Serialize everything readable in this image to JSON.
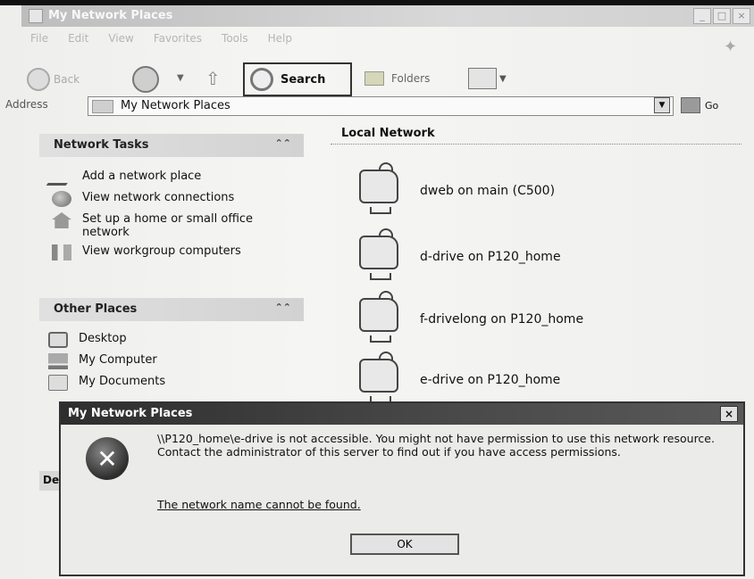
{
  "window": {
    "title": "My Network Places",
    "controls": [
      "_",
      "□",
      "×"
    ]
  },
  "menu": [
    "File",
    "Edit",
    "View",
    "Favorites",
    "Tools",
    "Help"
  ],
  "toolbar": {
    "back_label": "Back",
    "search_label": "Search",
    "folders_label": "Folders"
  },
  "address": {
    "label": "Address",
    "value": "My Network Places",
    "go_label": "Go"
  },
  "network_tasks": {
    "title": "Network Tasks",
    "items": [
      {
        "label": "Add a network place",
        "icon": "add-network-place-icon"
      },
      {
        "label": "View network connections",
        "icon": "network-connections-icon"
      },
      {
        "label": "Set up a home or small office network",
        "icon": "home-network-icon"
      },
      {
        "label": "View workgroup computers",
        "icon": "workgroup-icon"
      }
    ]
  },
  "other_places": {
    "title": "Other Places",
    "items": [
      {
        "label": "Desktop",
        "icon": "desktop-icon"
      },
      {
        "label": "My Computer",
        "icon": "my-computer-icon"
      },
      {
        "label": "My Documents",
        "icon": "my-documents-icon"
      }
    ]
  },
  "details_fragment": "De",
  "local_network": {
    "title": "Local Network",
    "shares": [
      {
        "label": "dweb on main (C500)"
      },
      {
        "label": "d-drive on P120_home"
      },
      {
        "label": "f-drivelong on P120_home"
      },
      {
        "label": "e-drive on P120_home"
      }
    ]
  },
  "dialog": {
    "title": "My Network Places",
    "message": "\\\\P120_home\\e-drive is not accessible. You might not have permission to use this network resource. Contact the administrator of this server to find out if you have access permissions.",
    "detail": "The network name cannot be found.",
    "ok_label": "OK"
  }
}
